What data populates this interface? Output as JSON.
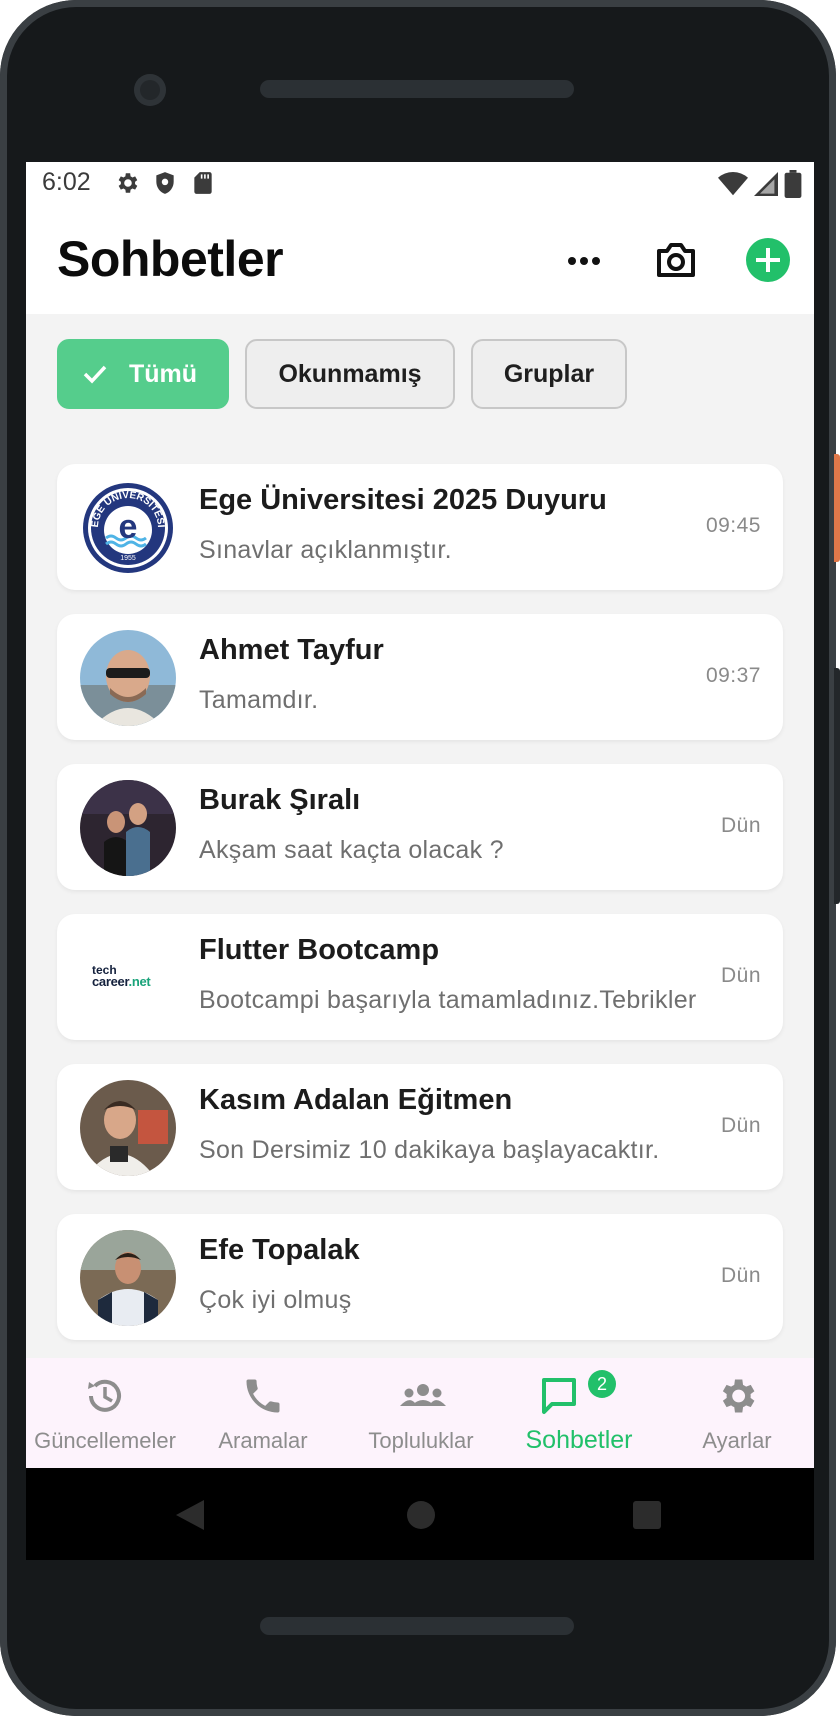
{
  "status_bar": {
    "time": "6:02",
    "left_icons": [
      "settings-icon",
      "shield-icon",
      "sd-card-icon"
    ],
    "right_icons": [
      "wifi-icon",
      "signal-icon",
      "battery-icon"
    ]
  },
  "header": {
    "title": "Sohbetler",
    "actions": [
      "more-icon",
      "camera-icon",
      "add-icon"
    ],
    "accent_color": "#22c06a"
  },
  "filters": [
    {
      "label": "Tümü",
      "selected": true
    },
    {
      "label": "Okunmamış",
      "selected": false
    },
    {
      "label": "Gruplar",
      "selected": false
    }
  ],
  "chats": [
    {
      "name": "Ege Üniversitesi 2025 Duyuru",
      "message": "Sınavlar açıklanmıştır.",
      "time": "09:45",
      "avatar_logo_text": "EGE ÜNİVERSİTESİ 1955"
    },
    {
      "name": "Ahmet Tayfur",
      "message": "Tamamdır.",
      "time": "09:37"
    },
    {
      "name": "Burak Şıralı",
      "message": "Akşam saat kaçta olacak ?",
      "time": "Dün"
    },
    {
      "name": "Flutter Bootcamp",
      "message": "Bootcampi başarıyla tamamladınız.Tebrikler",
      "time": "Dün",
      "avatar_logo_text": [
        "tech",
        "career",
        ".net"
      ]
    },
    {
      "name": "Kasım Adalan Eğitmen",
      "message": "Son Dersimiz 10 dakikaya başlayacaktır.",
      "time": "Dün"
    },
    {
      "name": "Efe Topalak",
      "message": "Çok iyi olmuş",
      "time": "Dün"
    }
  ],
  "bottom_nav": [
    {
      "label": "Güncellemeler",
      "icon": "updates-icon",
      "active": false
    },
    {
      "label": "Aramalar",
      "icon": "phone-icon",
      "active": false
    },
    {
      "label": "Topluluklar",
      "icon": "communities-icon",
      "active": false
    },
    {
      "label": "Sohbetler",
      "icon": "chat-icon",
      "active": true,
      "badge": "2"
    },
    {
      "label": "Ayarlar",
      "icon": "settings-icon",
      "active": false
    }
  ]
}
